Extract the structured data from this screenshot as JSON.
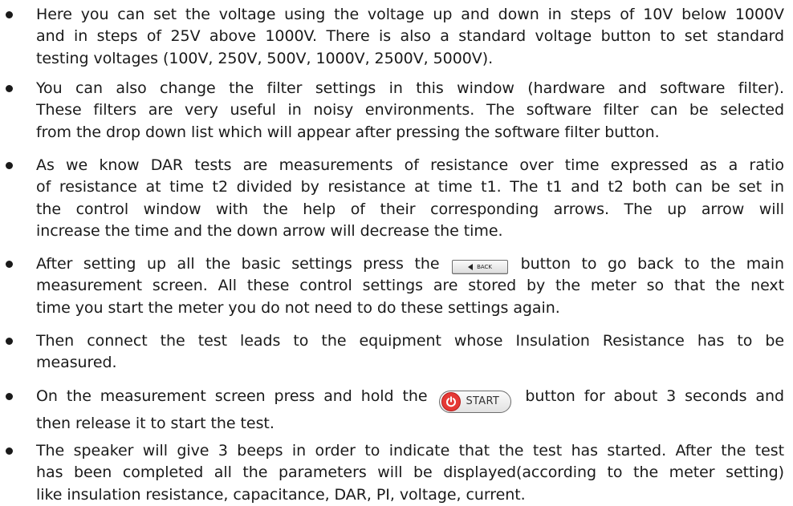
{
  "items": [
    {
      "lines": [
        "Here you can set the voltage using the voltage up and down in steps of 10V below 1000V",
        "and in steps of 25V above 1000V. There is also a standard voltage button to set standard",
        "testing voltages (100V, 250V, 500V, 1000V, 2500V, 5000V)."
      ]
    },
    {
      "lines": [
        "You can also change the filter settings in this window (hardware and software filter).",
        "These filters are very useful in noisy environments. The software filter can be selected",
        "from the drop down list which will appear after pressing the software filter button."
      ]
    },
    {
      "lines": [
        "As we know DAR tests are measurements of resistance over time expressed as a ratio",
        "of resistance at time t2 divided by resistance at time t1. The t1 and t2 both can be set in",
        "the control window with the help of their corresponding arrows. The up arrow will",
        "increase the time and the down arrow will decrease the time."
      ]
    },
    {
      "line1_before": "After setting up all the basic settings press the",
      "line1_after": "button to go back to the main",
      "lines": [
        "measurement screen. All these control settings are stored by the meter so that the next",
        "time you start the meter you do not need to do these settings again."
      ]
    },
    {
      "lines": [
        "Then connect the test leads to the equipment whose Insulation Resistance has to be",
        "measured."
      ]
    },
    {
      "line1_before": "On the measurement screen press and hold the",
      "line1_after": "button for about 3 seconds and",
      "lines": [
        "then release it to start the test."
      ]
    },
    {
      "lines": [
        "The speaker will give 3 beeps in order to indicate that the test has started. After the test",
        "has been completed all the parameters will be displayed(according to the meter setting)",
        "like insulation resistance, capacitance, DAR, PI, voltage, current."
      ]
    }
  ],
  "buttons": {
    "back_label": "BACK",
    "start_label": "START",
    "start_icon": "power-icon",
    "back_icon": "left-arrow-icon",
    "start_icon_color": "#e53935"
  }
}
